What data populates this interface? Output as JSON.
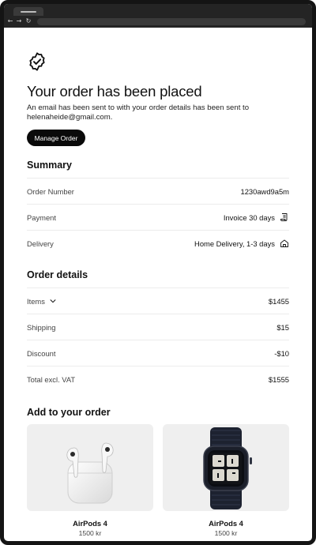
{
  "order": {
    "title": "Your order has been placed",
    "description": "An email has been sent to with your order details has been sent to helenaheide@gmail.com.",
    "manage_label": "Manage Order"
  },
  "summary": {
    "heading": "Summary",
    "rows": [
      {
        "label": "Order Number",
        "value": "1230awd9a5m",
        "icon": ""
      },
      {
        "label": "Payment",
        "value": "Invoice 30 days",
        "icon": "invoice-icon"
      },
      {
        "label": "Delivery",
        "value": "Home Delivery, 1-3 days",
        "icon": "home-icon"
      }
    ]
  },
  "order_details": {
    "heading": "Order details",
    "rows": [
      {
        "label": "Items",
        "value": "$1455",
        "expandable": true
      },
      {
        "label": "Shipping",
        "value": "$15"
      },
      {
        "label": "Discount",
        "value": "-$10"
      },
      {
        "label": "Total excl. VAT",
        "value": "$1555"
      }
    ]
  },
  "upsell": {
    "heading": "Add to your order",
    "products": [
      {
        "name": "AirPods 4",
        "price": "1500 kr",
        "image": "airpods-image"
      },
      {
        "name": "AirPods 4",
        "price": "1500 kr",
        "image": "watch-image"
      }
    ]
  },
  "colors": {
    "primary": "#0a0a0a",
    "card_bg": "#efefef",
    "divider": "#ececec",
    "action_green": "#dff3e3",
    "action_dark": "#111111"
  }
}
